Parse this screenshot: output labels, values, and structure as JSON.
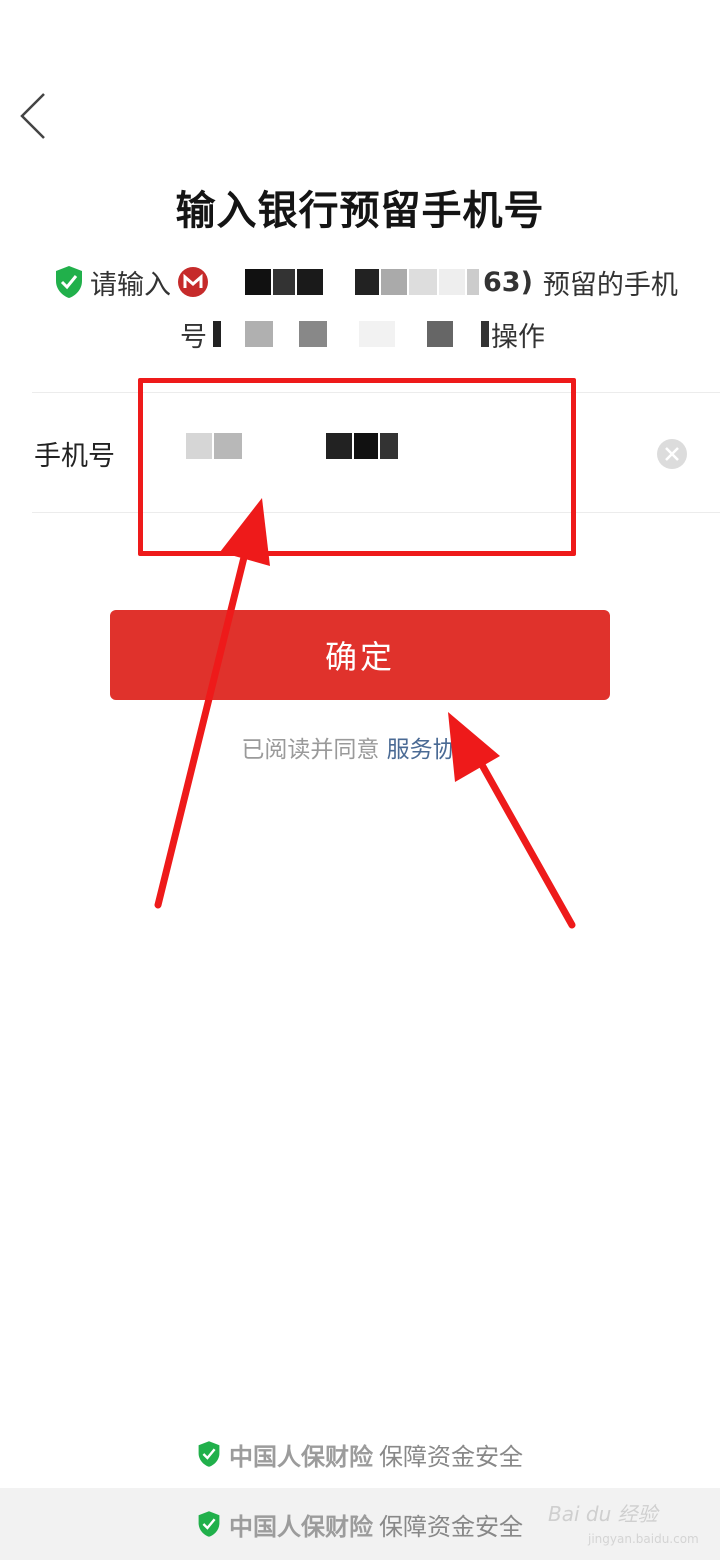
{
  "header": {
    "title": "输入银行预留手机号"
  },
  "notice": {
    "prefix": "请输入",
    "card_suffix": "63)",
    "line1_tail": "预留的手机",
    "line2_head": "号",
    "line2_tail": "操作"
  },
  "form": {
    "phone_label": "手机号"
  },
  "actions": {
    "confirm_label": "确定",
    "agree_prefix": "已阅读并同意",
    "agreement_link": "服务协议"
  },
  "footer": {
    "brand": "中国人保财险",
    "slogan": "保障资金安全",
    "watermark": "Bai du 经验",
    "watermark_url": "jingyan.baidu.com"
  },
  "colors": {
    "primary_red": "#e0322c",
    "annotation_red": "#ee1a1a",
    "secure_green": "#21b04b",
    "link_blue": "#4a6a94"
  },
  "icons": {
    "back": "chevron-left-icon",
    "secure": "shield-check-icon",
    "bank": "bank-logo-icon",
    "clear": "clear-circle-icon"
  }
}
